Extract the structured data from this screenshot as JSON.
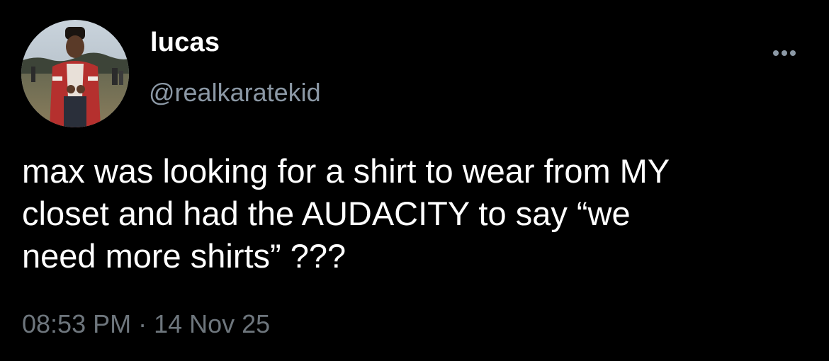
{
  "author": {
    "display_name": "lucas",
    "handle": "@realkaratekid",
    "avatar_icon": "profile-photo"
  },
  "tweet": {
    "text": "max was looking for a shirt to wear from MY\ncloset and had the AUDACITY to say “we\nneed more shirts” ???",
    "time": "08:53 PM",
    "separator": "·",
    "date": "14 Nov 25"
  },
  "actions": {
    "more_icon": "more-options-icon"
  },
  "colors": {
    "background": "#000000",
    "primary_text": "#ffffff",
    "secondary_text": "#8b98a5",
    "meta_text": "#6e767d"
  }
}
